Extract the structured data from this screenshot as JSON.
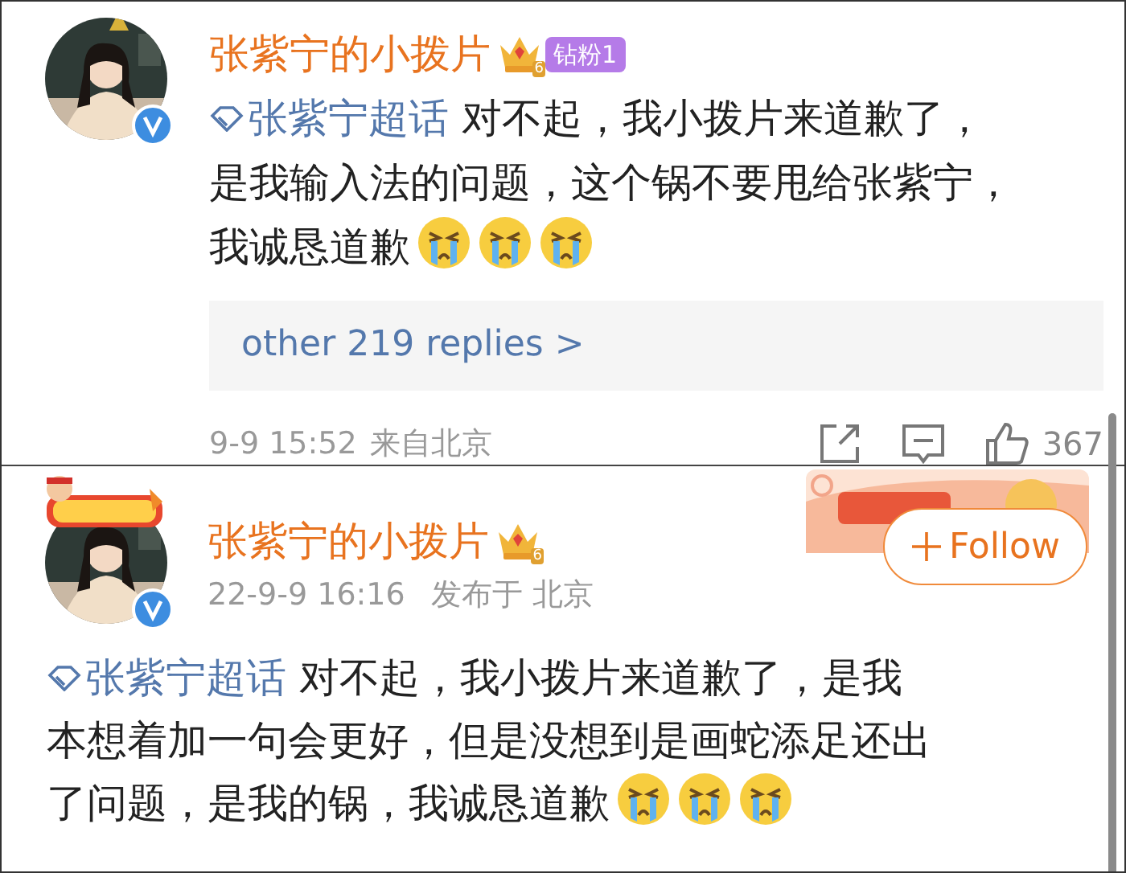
{
  "comment": {
    "name": "张紫宁的小拨片",
    "crown_level": "6",
    "fan_badge": "钻粉1",
    "verified": true,
    "topic": "张紫宁超话",
    "lines": [
      "对不起，我小拨片来道歉了，",
      "是我输入法的问题，这个锅不要甩给张紫宁，",
      "我诚恳道歉"
    ],
    "emojis": [
      {
        "kind": "crying"
      },
      {
        "kind": "crying"
      },
      {
        "kind": "crying"
      }
    ],
    "replies": "other 219 replies >",
    "time": "9-9 15:52",
    "location": "来自北京",
    "likes": "367"
  },
  "post": {
    "name": "张紫宁的小拨片",
    "crown_level": "6",
    "verified": true,
    "time": "22-9-9 16:16",
    "location": "发布于 北京",
    "follow": "Follow",
    "topic": "张紫宁超话",
    "lines": [
      "对不起，我小拨片来道歉了，是我",
      "本想着加一句会更好，但是没想到是画蛇添足还出",
      "了问题，是我的锅，我诚恳道歉"
    ],
    "emojis": [
      {
        "kind": "crying"
      },
      {
        "kind": "crying"
      },
      {
        "kind": "crying"
      }
    ]
  }
}
